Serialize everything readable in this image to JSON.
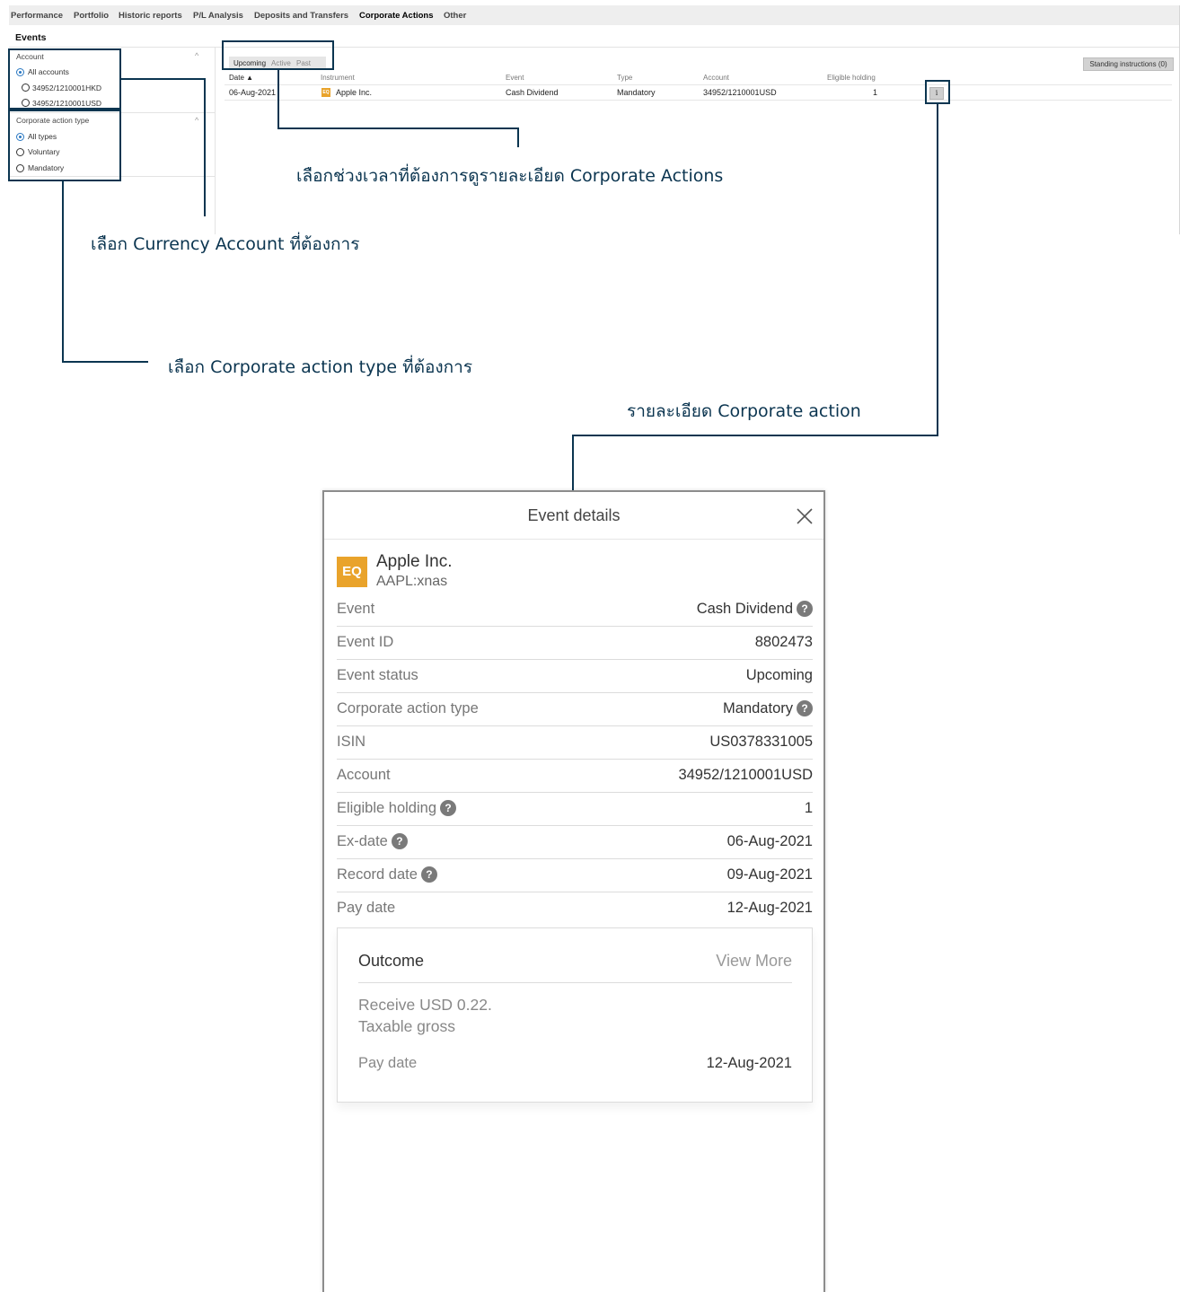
{
  "nav": {
    "items": [
      "Performance",
      "Portfolio",
      "Historic reports",
      "P/L Analysis",
      "Deposits and Transfers",
      "Corporate Actions",
      "Other"
    ],
    "active": "Corporate Actions"
  },
  "events_title": "Events",
  "sidebar": {
    "account_heading": "Account",
    "accounts": [
      "All accounts",
      "34952/1210001HKD",
      "34952/1210001USD"
    ],
    "selected_account": "All accounts",
    "type_heading": "Corporate action type",
    "types": [
      "All types",
      "Voluntary",
      "Mandatory"
    ],
    "selected_type": "All types"
  },
  "period_tabs": [
    "Upcoming",
    "Active",
    "Past"
  ],
  "active_period": "Upcoming",
  "standing_instructions": "Standing instructions (0)",
  "table": {
    "columns": [
      "Date ▲",
      "Instrument",
      "Event",
      "Type",
      "Account",
      "Eligible holding"
    ],
    "rows": [
      {
        "date": "06-Aug-2021",
        "instrument_badge": "EQ",
        "instrument": "Apple Inc.",
        "event": "Cash Dividend",
        "type": "Mandatory",
        "account": "34952/1210001USD",
        "holding": "1",
        "info": "i"
      }
    ]
  },
  "annotations": {
    "period": "เลือกช่วงเวลาที่ต้องการดูรายละเอียด Corporate Actions",
    "account": "เลือก Currency Account ที่ต้องการ",
    "type": "เลือก Corporate action type ที่ต้องการ",
    "detail": "รายละเอียด Corporate action"
  },
  "modal": {
    "title": "Event details",
    "badge": "EQ",
    "instrument": "Apple Inc.",
    "symbol": "AAPL:xnas",
    "details": [
      {
        "label": "Event",
        "value": "Cash Dividend",
        "value_help": true
      },
      {
        "label": "Event ID",
        "value": "8802473"
      },
      {
        "label": "Event status",
        "value": "Upcoming"
      },
      {
        "label": "Corporate action type",
        "value": "Mandatory",
        "value_help": true
      },
      {
        "label": "ISIN",
        "value": "US0378331005"
      },
      {
        "label": "Account",
        "value": "34952/1210001USD"
      },
      {
        "label": "Eligible holding",
        "value": "1",
        "label_help": true
      },
      {
        "label": "Ex-date",
        "value": "06-Aug-2021",
        "label_help": true
      },
      {
        "label": "Record date",
        "value": "09-Aug-2021",
        "label_help": true
      },
      {
        "label": "Pay date",
        "value": "12-Aug-2021"
      }
    ],
    "outcome": {
      "title": "Outcome",
      "view_more": "View More",
      "desc_line1": "Receive USD 0.22.",
      "desc_line2": "Taxable gross",
      "pay_date_label": "Pay date",
      "pay_date_value": "12-Aug-2021"
    },
    "help_glyph": "?"
  },
  "colors": {
    "annotation": "#0b3550",
    "eq_badge": "#e9a32b",
    "radio_selected": "#2a78c2"
  }
}
